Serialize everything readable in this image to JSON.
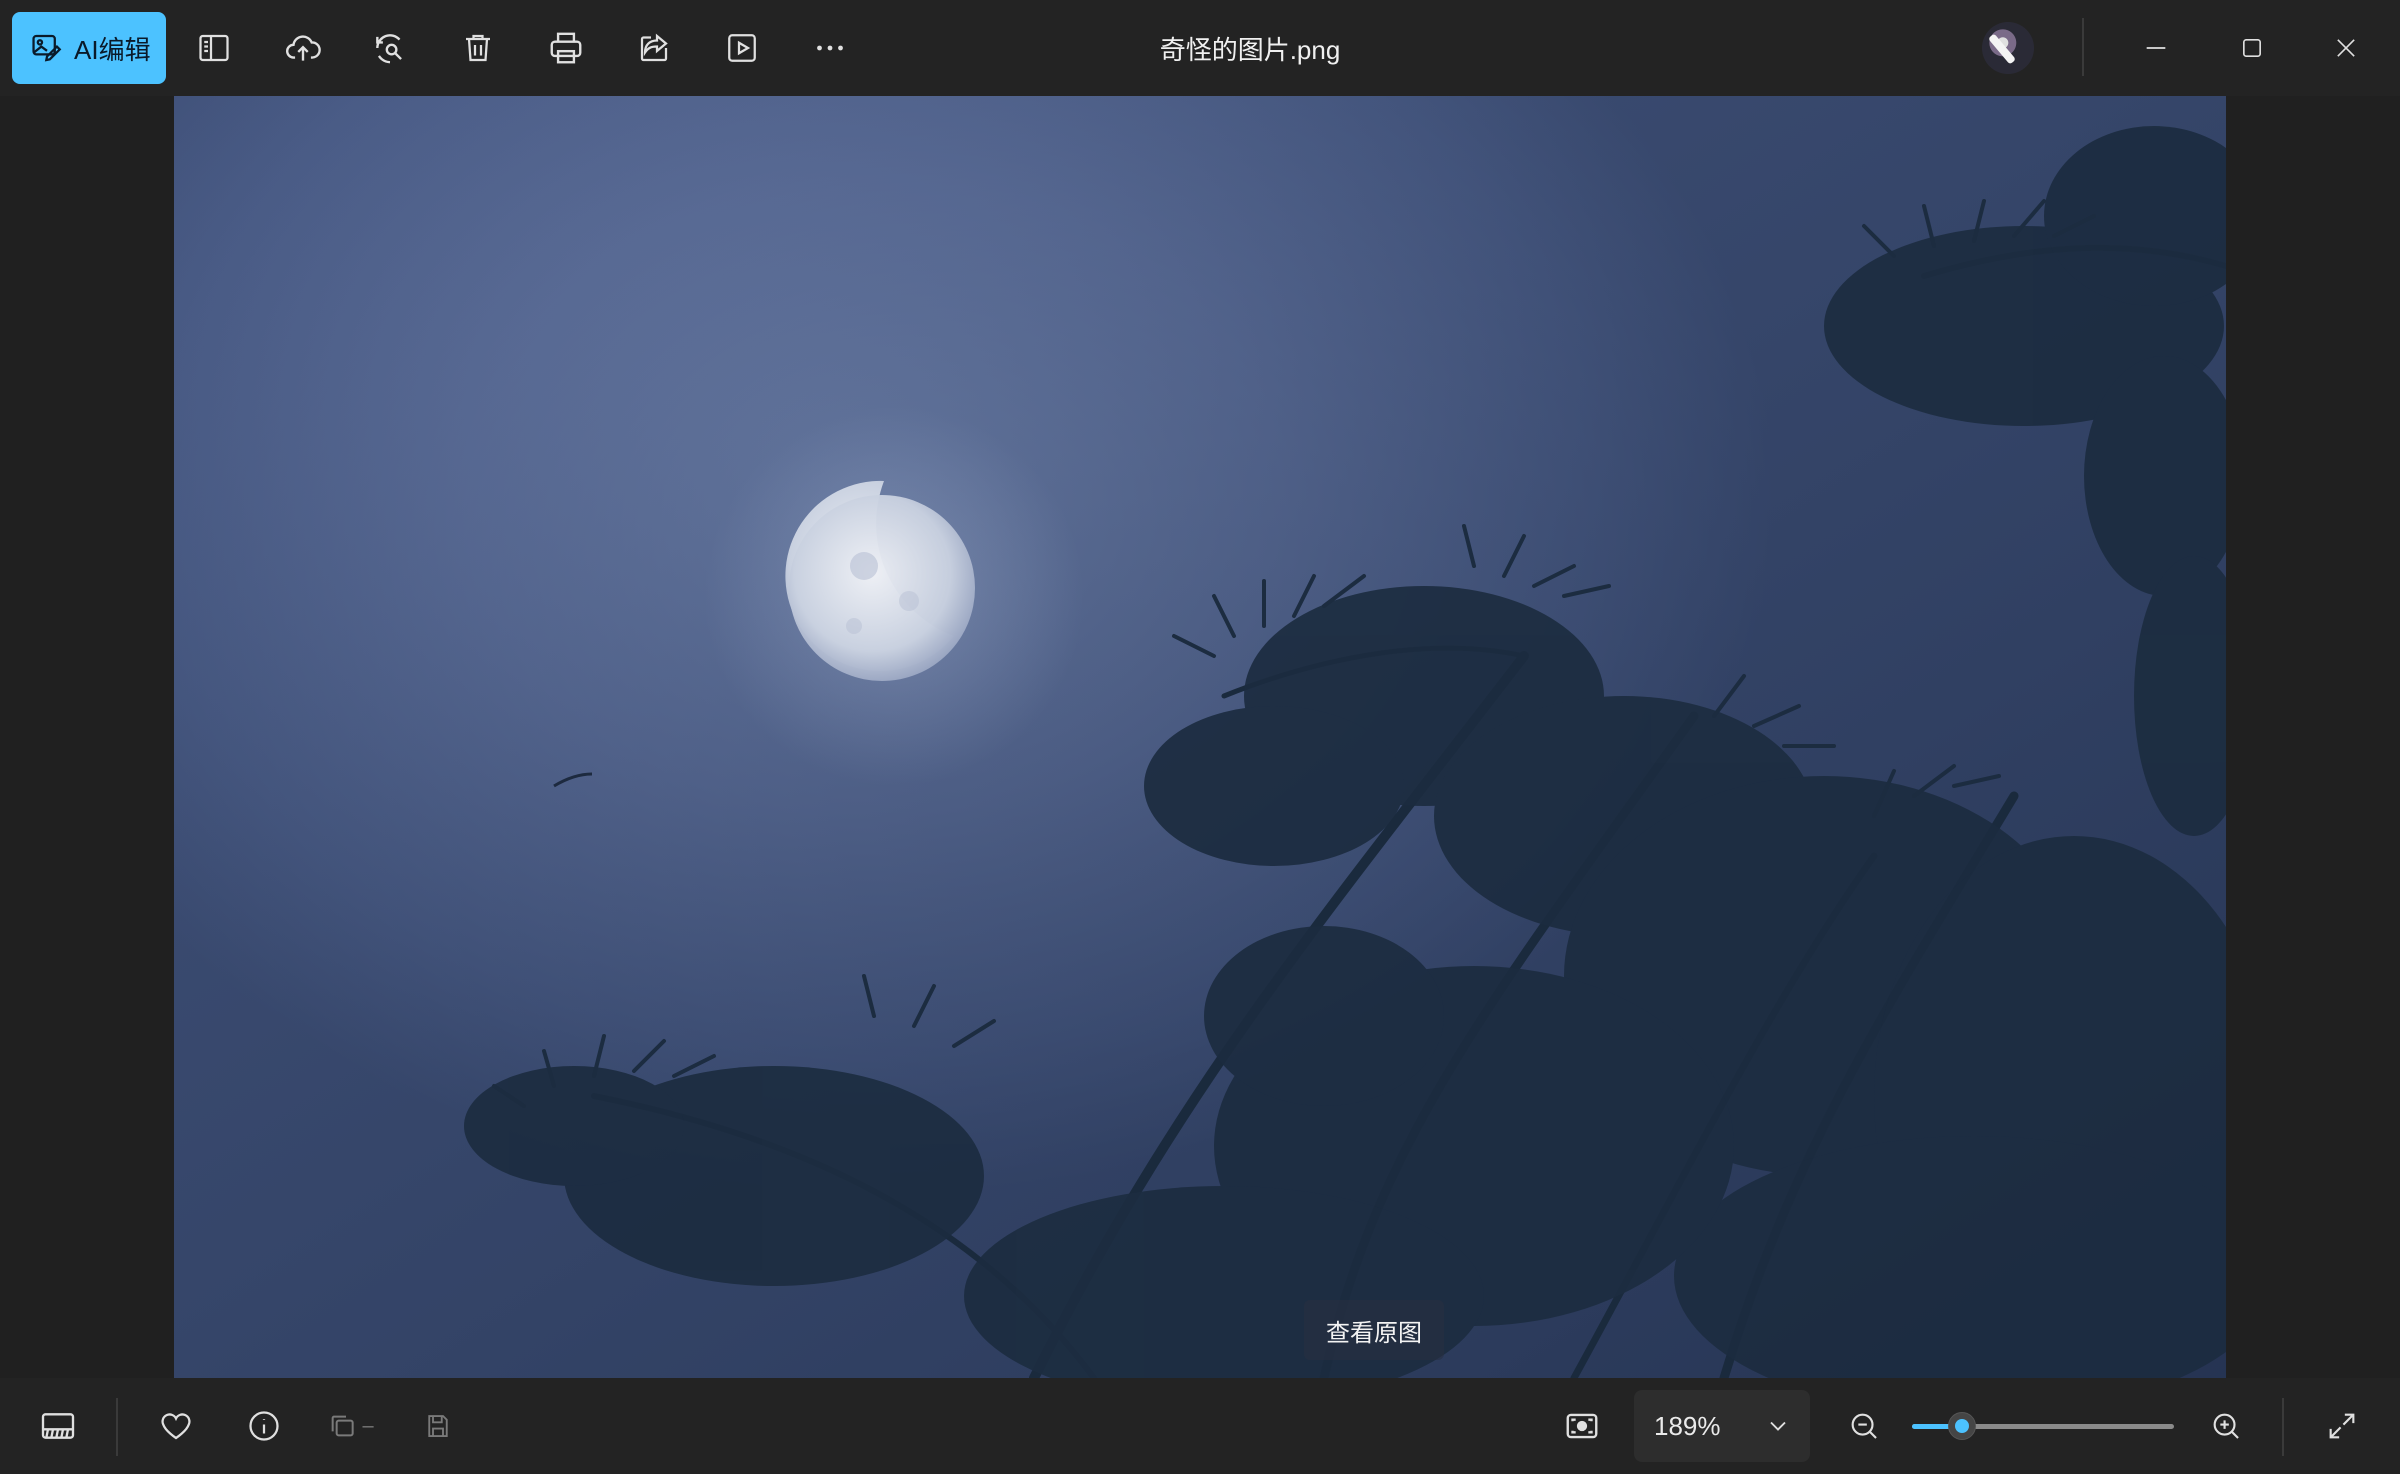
{
  "toolbar": {
    "ai_edit_label": "AI编辑",
    "icons": [
      "ai-edit-icon",
      "sidebar-panel-icon",
      "cloud-upload-icon",
      "rotate-search-icon",
      "delete-icon",
      "print-icon",
      "share-icon",
      "slideshow-icon",
      "more-icon"
    ]
  },
  "window": {
    "title": "奇怪的图片.png"
  },
  "image": {
    "overlay_button": "查看原图"
  },
  "bottombar": {
    "zoom_value": "189%",
    "zoom_level": 0.19,
    "icons": [
      "filmstrip-icon",
      "favorite-icon",
      "info-icon",
      "copy-icon",
      "save-icon",
      "actual-size-icon",
      "zoom-out-icon",
      "zoom-in-icon",
      "fullscreen-icon"
    ]
  },
  "colors": {
    "accent": "#4cc2ff",
    "toolbar_bg": "#232323",
    "background": "#202020"
  }
}
